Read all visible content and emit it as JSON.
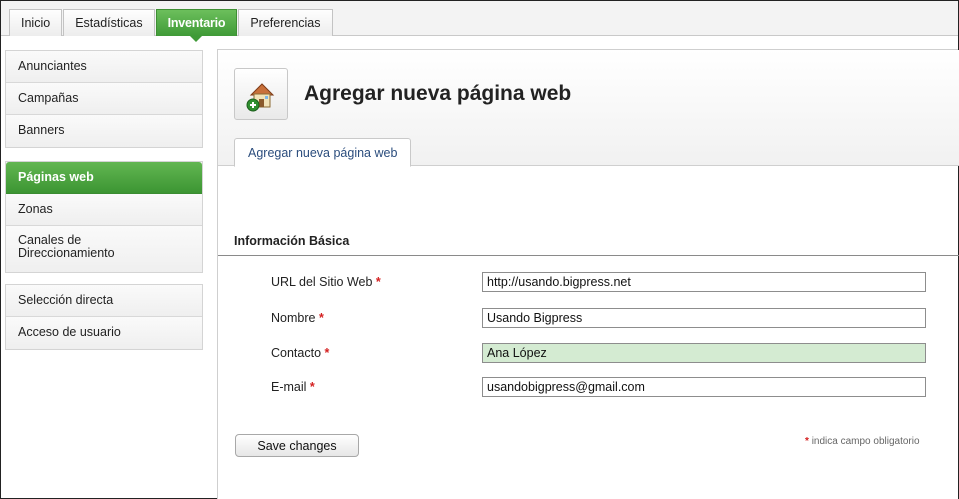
{
  "top_tabs": [
    {
      "label": "Inicio"
    },
    {
      "label": "Estadísticas"
    },
    {
      "label": "Inventario"
    },
    {
      "label": "Preferencias"
    }
  ],
  "sidebar": {
    "group1": [
      {
        "label": "Anunciantes"
      },
      {
        "label": "Campañas"
      },
      {
        "label": "Banners"
      }
    ],
    "group2": [
      {
        "label": "Páginas web"
      },
      {
        "label": "Zonas"
      },
      {
        "label": "Canales de",
        "label2": "Direccionamiento"
      }
    ],
    "group3": [
      {
        "label": "Selección directa"
      },
      {
        "label": "Acceso de usuario"
      }
    ]
  },
  "main": {
    "page_icon": "add-website-house-icon",
    "page_title": "Agregar nueva página web",
    "subtab_label": "Agregar nueva página web",
    "section_title": "Información Básica",
    "fields": [
      {
        "label": "URL del Sitio Web",
        "value": "http://usando.bigpress.net"
      },
      {
        "label": "Nombre",
        "value": "Usando Bigpress"
      },
      {
        "label": "Contacto",
        "value": "Ana López"
      },
      {
        "label": "E-mail",
        "value": "usandobigpress@gmail.com"
      }
    ],
    "required_mark": "*",
    "save_label": "Save changes",
    "required_note": "indica campo obligatorio"
  },
  "colors": {
    "active_green": "#4aa63f",
    "focused_field": "#d4ebd2",
    "required_red": "#d42020",
    "link_blue": "#2b4d7d"
  }
}
